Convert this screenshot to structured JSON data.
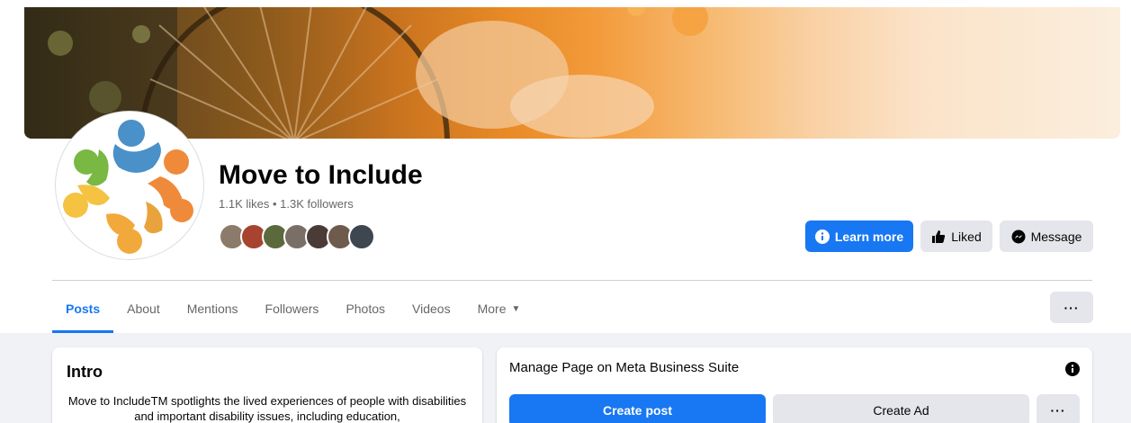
{
  "page": {
    "name": "Move to Include",
    "stats": "1.1K likes • 1.3K followers"
  },
  "actions": {
    "learn_more": "Learn more",
    "liked": "Liked",
    "message": "Message"
  },
  "tabs": [
    {
      "label": "Posts",
      "active": true
    },
    {
      "label": "About",
      "active": false
    },
    {
      "label": "Mentions",
      "active": false
    },
    {
      "label": "Followers",
      "active": false
    },
    {
      "label": "Photos",
      "active": false
    },
    {
      "label": "Videos",
      "active": false
    },
    {
      "label": "More",
      "active": false
    }
  ],
  "tabs_more_label": "···",
  "intro": {
    "title": "Intro",
    "text": "Move to IncludeTM spotlights the lived experiences of people with disabilities and important disability issues, including education,"
  },
  "manage": {
    "title": "Manage Page on Meta Business Suite",
    "create_post": "Create post",
    "create_ad": "Create Ad",
    "more": "···"
  },
  "colors": {
    "accent": "#1877f2",
    "secondary_button": "#e4e6eb",
    "muted_text": "#65676b",
    "feed_background": "#f0f2f5"
  }
}
